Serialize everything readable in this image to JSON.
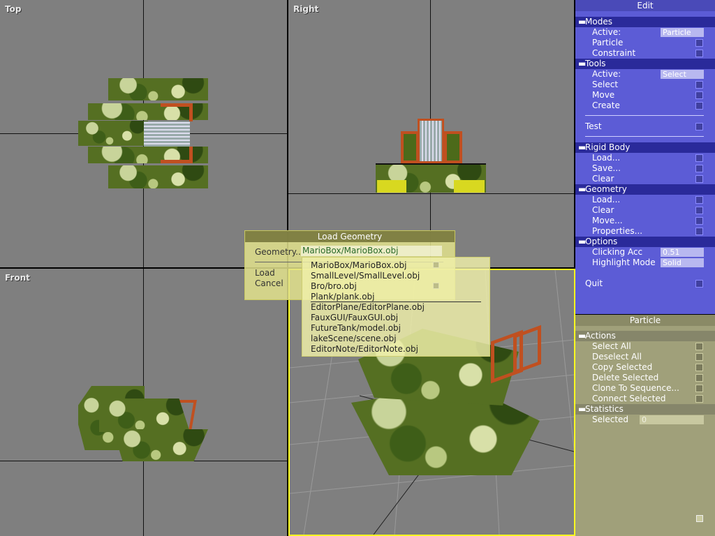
{
  "viewports": {
    "top": {
      "label": "Top"
    },
    "right": {
      "label": "Right"
    },
    "front": {
      "label": "Front"
    }
  },
  "edit_panel": {
    "title": "Edit",
    "modes": {
      "header": "Modes",
      "active_label": "Active:",
      "active_value": "Particle",
      "items": [
        "Particle",
        "Constraint"
      ]
    },
    "tools": {
      "header": "Tools",
      "active_label": "Active:",
      "active_value": "Select",
      "items": [
        "Select",
        "Move",
        "Create"
      ]
    },
    "test_label": "Test",
    "rigid_body": {
      "header": "Rigid Body",
      "items": [
        "Load...",
        "Save...",
        "Clear"
      ]
    },
    "geometry": {
      "header": "Geometry",
      "items": [
        "Load...",
        "Clear",
        "Move...",
        "Properties..."
      ]
    },
    "options": {
      "header": "Options",
      "clicking_acc_label": "Clicking Acc",
      "clicking_acc_value": "0.51",
      "highlight_label": "Highlight Mode",
      "highlight_value": "Solid"
    },
    "quit_label": "Quit"
  },
  "particle_panel": {
    "title": "Particle",
    "actions": {
      "header": "Actions",
      "items": [
        "Select All",
        "Deselect All",
        "Copy Selected",
        "Delete Selected",
        "Clone To Sequence...",
        "Connect Selected"
      ]
    },
    "statistics": {
      "header": "Statistics",
      "selected_label": "Selected",
      "selected_value": "0"
    }
  },
  "load_dialog": {
    "title": "Load Geometry",
    "geometry_label": "Geometry..",
    "geometry_value": "MarioBox/MarioBox.obj",
    "load_label": "Load",
    "cancel_label": "Cancel"
  },
  "dropdown": {
    "items": [
      "MarioBox/MarioBox.obj",
      "SmallLevel/SmallLevel.obj",
      "Bro/bro.obj",
      "Plank/plank.obj",
      "EditorPlane/EditorPlane.obj",
      "FauxGUI/FauxGUI.obj",
      "FutureTank/model.obj",
      "lakeScene/scene.obj",
      "EditorNote/EditorNote.obj"
    ]
  }
}
